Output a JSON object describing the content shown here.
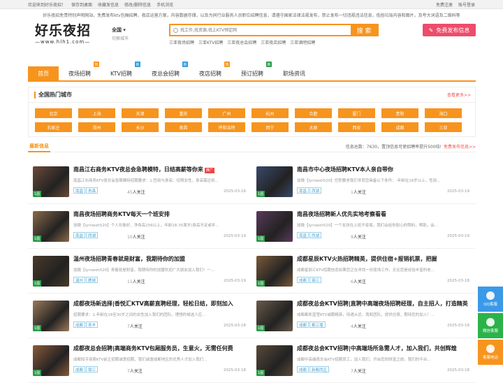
{
  "topbar": {
    "left": [
      "欢迎来到好乐夜招！",
      "保存到桌面",
      "收藏发信息",
      "修改/删除信息",
      "手机浏览"
    ],
    "right": [
      "免费注册",
      "账号登录"
    ]
  },
  "notice": "好乐夜招免责特别声明网站，免费发布ktv包厢招聘，夜店运营方案，内容数据存储，以及为同行业服务人员职位招聘信息，请遵守国家法律法规发布，禁止发布一切违规违法信息，低俗垃圾内容和图片，及夸大词语及二维码等",
  "logo": {
    "main": "好乐夜招",
    "sub": "—www.hlh1.com—"
  },
  "city": {
    "name": "全国",
    "switch": "切换城市"
  },
  "search": {
    "placeholder": "找工作,找资源,找上KTV预定网",
    "button": "搜 索"
  },
  "hotkw": [
    "三亚夜场招聘",
    "三亚KTV招聘",
    "三亚夜总会招聘",
    "三亚夜店招聘",
    "三亚酒吧招聘"
  ],
  "publish": "免费发布信息",
  "colors": {
    "accent": "#f7941d",
    "pink": "#ed4c6b"
  },
  "nav": [
    {
      "label": "首页",
      "active": true,
      "badge": ""
    },
    {
      "label": "夜场招聘",
      "badge": "热",
      "badgeColor": "#f7941d"
    },
    {
      "label": "KTV招聘",
      "badge": "新",
      "badgeColor": "#2b9ae0"
    },
    {
      "label": "夜总会招聘",
      "badge": "新",
      "badgeColor": "#2b9ae0"
    },
    {
      "label": "夜店招聘",
      "badge": "热",
      "badgeColor": "#f7941d"
    },
    {
      "label": "预订招聘",
      "badge": "新",
      "badgeColor": "#2b9a48"
    },
    {
      "label": "职场资讯",
      "badge": ""
    }
  ],
  "cities": {
    "title": "全国热门城市",
    "more": "查看更多>>",
    "list": [
      "北京",
      "上海",
      "天津",
      "重庆",
      "广州",
      "杭州",
      "合肥",
      "厦门",
      "贵阳",
      "海口",
      "石家庄",
      "郑州",
      "长沙",
      "南昌",
      "呼和浩特",
      "西宁",
      "太原",
      "西安",
      "成都",
      "三亚"
    ]
  },
  "latest": {
    "title": "最新信息",
    "info": "信息总数：7630，置顶信息可使招聘率提升500倍!",
    "pub": "免费发布信息>>"
  },
  "posts": [
    {
      "title": "南昌江右商务KTV夜总会急聘模特，日结高薪等你来",
      "top": "推广",
      "desc": "南昌江右商务KTV夜总会急聘模特招聘要求：1.性别与身高：仅限女性，身高需达到...",
      "tags": [
        "南昌",
        "青森"
      ],
      "attn": "45",
      "date": "2025-03-16",
      "img": "#6b4a3a"
    },
    {
      "title": "南昌市中心夜场招聘KTV本人亲自带你",
      "top": "",
      "desc": "加微【lyrnwsh520】任职要求我们寻觅您具备以下条件：-年龄在18岁以上，性别...",
      "tags": [
        "南昌",
        "西湖"
      ],
      "attn": "1",
      "date": "2025-03-19",
      "img": "#3a4a6a"
    },
    {
      "title": "南昌夜场招聘商务KTV每天一个班安排",
      "top": "",
      "desc": "加微【lyrnwsh520】个人形象好，净身高156以上，年龄18-35周岁(身高不足或年...",
      "tags": [
        "南昌",
        "西湖"
      ],
      "attn": "10",
      "date": "2025-03-19",
      "img": "#8a6a4a"
    },
    {
      "title": "南昌夜场招聘新人优先实地考察看看",
      "top": "",
      "desc": "加微【lyrnwsh520】一个女孩在上班不容易。我们会给你耐心的照料，帮助，会...",
      "tags": [
        "南昌",
        "西湖"
      ],
      "attn": "9",
      "date": "2025-03-19",
      "img": "#5a3a5a"
    },
    {
      "title": "温州夜场招聘青春就是财富，我期待你的加盟",
      "top": "",
      "desc": "加微【lyrnwsh520】青春就是财富。我期待你的加盟欢迎广大朋友加入我们！一...",
      "tags": [
        "温州",
        "鹿城"
      ],
      "attn": "11",
      "date": "2025-03-19",
      "img": "#4a3a2a"
    },
    {
      "title": "成都星辰KTV火热招聘精英，提供住宿+报销机票，把握",
      "top": "",
      "desc": "成都星辰汇KTV招聘信息如果您正在寻找一份夜场工作，无论您是经验丰富的老...",
      "tags": [
        "成都",
        "锦江"
      ],
      "attn": "6",
      "date": "2025-03-18",
      "img": "#7a5a3a"
    },
    {
      "title": "成都夜场新选择|香悦汇KTV高薪直聘经理，轻松日结，即刻加入",
      "top": "",
      "desc": "招聘要求：1.年龄在18至30岁之间的女性加入我们的团队。理想的候选人应...",
      "tags": [
        "成都",
        "青羊"
      ],
      "attn": "7",
      "date": "2025-03-18",
      "img": "#9a7a5a"
    },
    {
      "title": "成都夜总会KTV招聘|直聘中高端夜场招聘经理，自主招人，打造精英",
      "top": "",
      "desc": "成都都凯蓝莹KTV诚聘精英，待遇从优，我和团队，提供住宿，期待您的加入！...",
      "tags": [
        "成都",
        "都江堰"
      ],
      "attn": "4",
      "date": "2025-03-18",
      "img": "#6a5a4a"
    },
    {
      "title": "成都夜总会招聘|高端商务KTV包厢服务员，生意火，无需任何费",
      "top": "",
      "desc": "成都知乎探索KTV前正招聘诚意招聘，我们诚邀成都地区的优秀人才加入我们...",
      "tags": [
        "成都",
        "锦江"
      ],
      "attn": "7",
      "date": "2025-03-18",
      "img": "#8a5a3a"
    },
    {
      "title": "成都夜总会KTV招聘|中高端场所急需人才，加入我们，共创辉煌",
      "top": "",
      "desc": "成都中高端夜总会KTV招聘员工，加入我们，开启您的财富之旅。我们的平台...",
      "tags": [
        "成都",
        "新都西区"
      ],
      "attn": "7",
      "date": "2025-03-18",
      "img": "#5a4a3a"
    }
  ],
  "float": [
    {
      "label": "QQ客服",
      "color": "#3a9ae8"
    },
    {
      "label": "微信客服",
      "color": "#2bb34a"
    },
    {
      "label": "客服电话",
      "color": "#f7941d"
    }
  ],
  "attn_label": "人关注"
}
